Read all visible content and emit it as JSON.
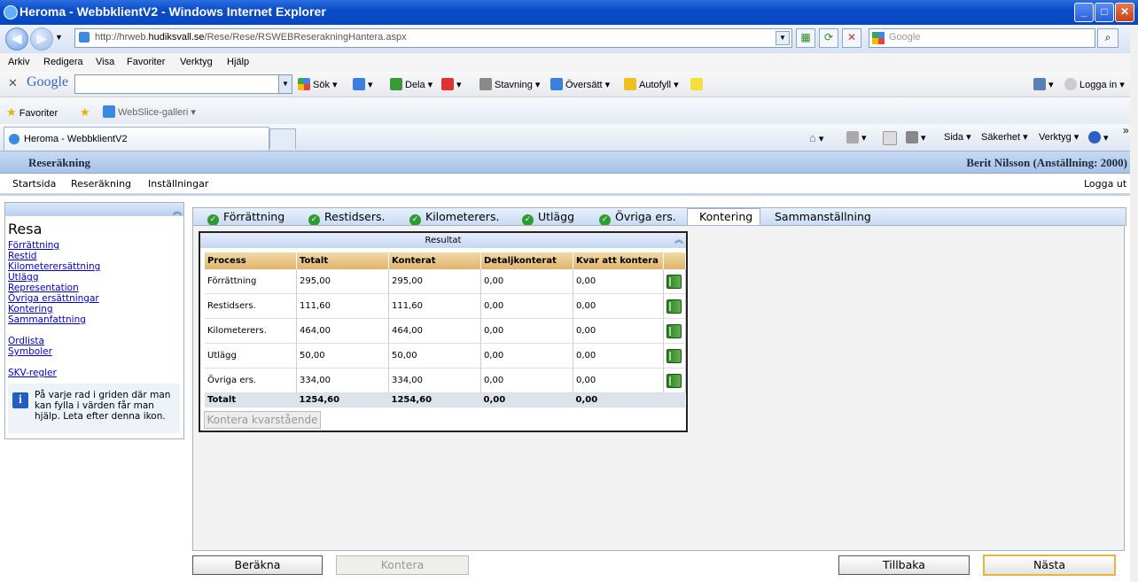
{
  "window": {
    "title": "Heroma - WebbklientV2 - Windows Internet Explorer",
    "min": "_",
    "max": "□",
    "close": "✕"
  },
  "addressbar": {
    "url_prefix": "http://hrweb.",
    "url_host": "hudiksvall.se",
    "url_path": "/Rese/Rese/RSWEBReserakningHantera.aspx",
    "search_placeholder": "Google"
  },
  "menubar": {
    "items": [
      "Arkiv",
      "Redigera",
      "Visa",
      "Favoriter",
      "Verktyg",
      "Hjälp"
    ]
  },
  "google_toolbar": {
    "logo": "Google",
    "items": [
      "Sök",
      "Dela",
      "Stavning",
      "Översätt",
      "Autofyll"
    ],
    "login": "Logga in"
  },
  "favorites": {
    "label": "Favoriter",
    "webslice": "WebSlice-galleri"
  },
  "tabs": {
    "active": "Heroma - WebbklientV2"
  },
  "commandbar": {
    "items": [
      "Sida",
      "Säkerhet",
      "Verktyg"
    ]
  },
  "app": {
    "title": "Reseräkning",
    "user": "Berit Nilsson (Anställning: 2000)",
    "nav": [
      "Startsida",
      "Reseräkning",
      "Inställningar"
    ],
    "logout": "Logga ut"
  },
  "sidebar": {
    "title": "Resa",
    "links": [
      "Förrättning",
      "Restid",
      "Kilometerersättning",
      "Utlägg",
      "Representation",
      "Övriga ersättningar",
      "Kontering",
      "Sammanfattning"
    ],
    "links2": [
      "Ordlista",
      "Symboler"
    ],
    "links3": [
      "SKV-regler"
    ],
    "info": "På varje rad i griden där man kan fylla i värden får man hjälp. Leta efter denna ikon."
  },
  "content_tabs": [
    "Förrättning",
    "Restidsers.",
    "Kilometerers.",
    "Utlägg",
    "Övriga ers.",
    "Kontering",
    "Sammanställning"
  ],
  "result": {
    "title": "Resultat",
    "columns": [
      "Process",
      "Totalt",
      "Konterat",
      "Detaljkonterat",
      "Kvar att kontera"
    ],
    "rows": [
      [
        "Förrättning",
        "295,00",
        "295,00",
        "0,00",
        "0,00"
      ],
      [
        "Restidsers.",
        "111,60",
        "111,60",
        "0,00",
        "0,00"
      ],
      [
        "Kilometerers.",
        "464,00",
        "464,00",
        "0,00",
        "0,00"
      ],
      [
        "Utlägg",
        "50,00",
        "50,00",
        "0,00",
        "0,00"
      ],
      [
        "Övriga ers.",
        "334,00",
        "334,00",
        "0,00",
        "0,00"
      ]
    ],
    "total": [
      "Totalt",
      "1254,60",
      "1254,60",
      "0,00",
      "0,00"
    ],
    "button": "Kontera kvarstående"
  },
  "buttons": {
    "calc": "Beräkna",
    "kontera": "Kontera",
    "back": "Tillbaka",
    "next": "Nästa"
  }
}
